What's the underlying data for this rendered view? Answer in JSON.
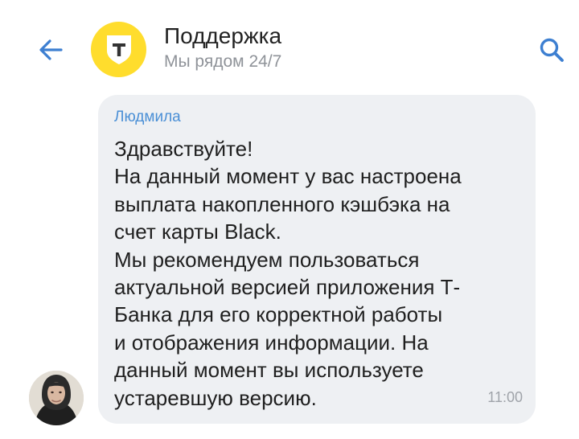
{
  "header": {
    "title": "Поддержка",
    "subtitle": "Мы рядом 24/7",
    "back_icon": "arrow-left-icon",
    "logo_icon": "t-bank-shield-icon",
    "search_icon": "search-icon",
    "accent_color": "#3d7fd1",
    "logo_color": "#ffdd2d"
  },
  "message": {
    "sender": "Людмила",
    "lines": [
      "Здравствуйте!",
      "На данный момент у вас настроена",
      "выплата накопленного кэшбэка на",
      "счет карты Black.",
      "Мы рекомендуем пользоваться",
      "актуальной версией приложения Т-",
      "Банка для его корректной работы",
      "и отображения информации. На",
      "данный момент вы используете",
      "устаревшую версию."
    ],
    "time": "11:00",
    "bubble_color": "#eef0f3",
    "sender_color": "#4a8fd6"
  }
}
